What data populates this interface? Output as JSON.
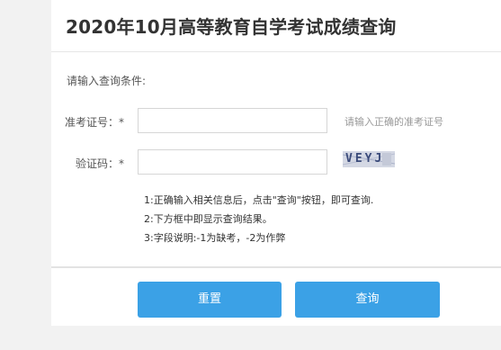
{
  "page": {
    "title": "2020年10月高等教育自学考试成绩查询"
  },
  "form": {
    "prompt": "请输入查询条件:",
    "ticket_label": "准考证号：*",
    "ticket_value": "",
    "ticket_hint": "请输入正确的准考证号",
    "captcha_label": "验证码：*",
    "captcha_value": "",
    "captcha_image_text": "VEYJ"
  },
  "notes": [
    "1:正确输入相关信息后，点击\"查询\"按钮，即可查询.",
    "2:下方框中即显示查询结果。",
    "3:字段说明:-1为缺考，-2为作弊"
  ],
  "buttons": {
    "reset_label": "重置",
    "query_label": "查询"
  },
  "colors": {
    "button_bg": "#3ba1e6",
    "page_bg": "#f2f2f2",
    "card_bg": "#ffffff"
  }
}
